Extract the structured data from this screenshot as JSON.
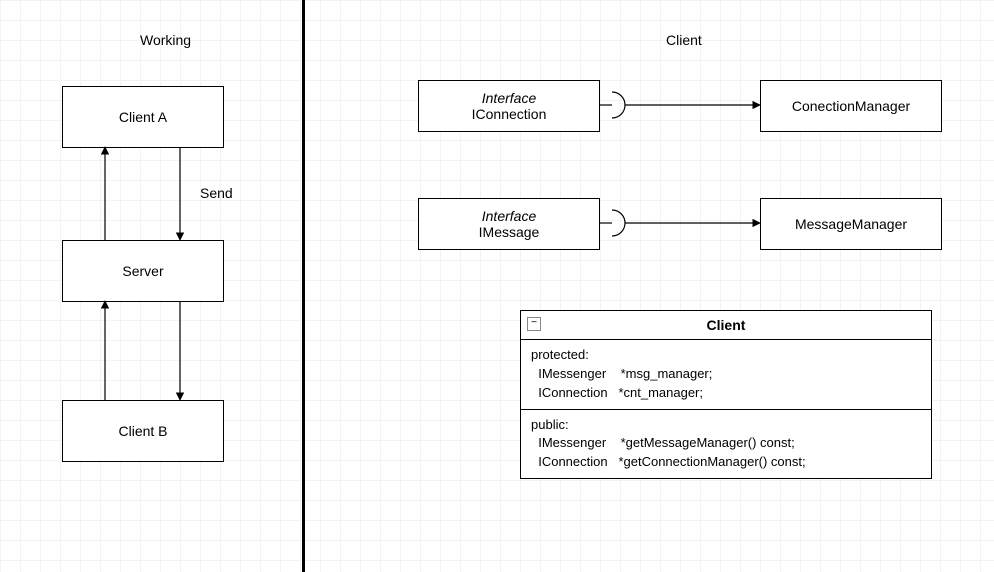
{
  "left": {
    "title": "Working",
    "clientA": "Client A",
    "server": "Server",
    "clientB": "Client B",
    "send": "Send"
  },
  "right": {
    "title": "Client",
    "iconnection": {
      "stereo": "Interface",
      "name": "IConnection"
    },
    "connectionManager": "ConectionManager",
    "imessage": {
      "stereo": "Interface",
      "name": "IMessage"
    },
    "messageManager": "MessageManager"
  },
  "classBox": {
    "name": "Client",
    "protected": {
      "label": "protected:",
      "rows": [
        {
          "type": "IMessenger",
          "decl": "*msg_manager;"
        },
        {
          "type": "IConnection",
          "decl": "*cnt_manager;"
        }
      ]
    },
    "public": {
      "label": "public:",
      "rows": [
        {
          "type": "IMessenger",
          "decl": "*getMessageManager() const;"
        },
        {
          "type": "IConnection",
          "decl": "*getConnectionManager() const;"
        }
      ]
    },
    "collapseGlyph": "−"
  }
}
